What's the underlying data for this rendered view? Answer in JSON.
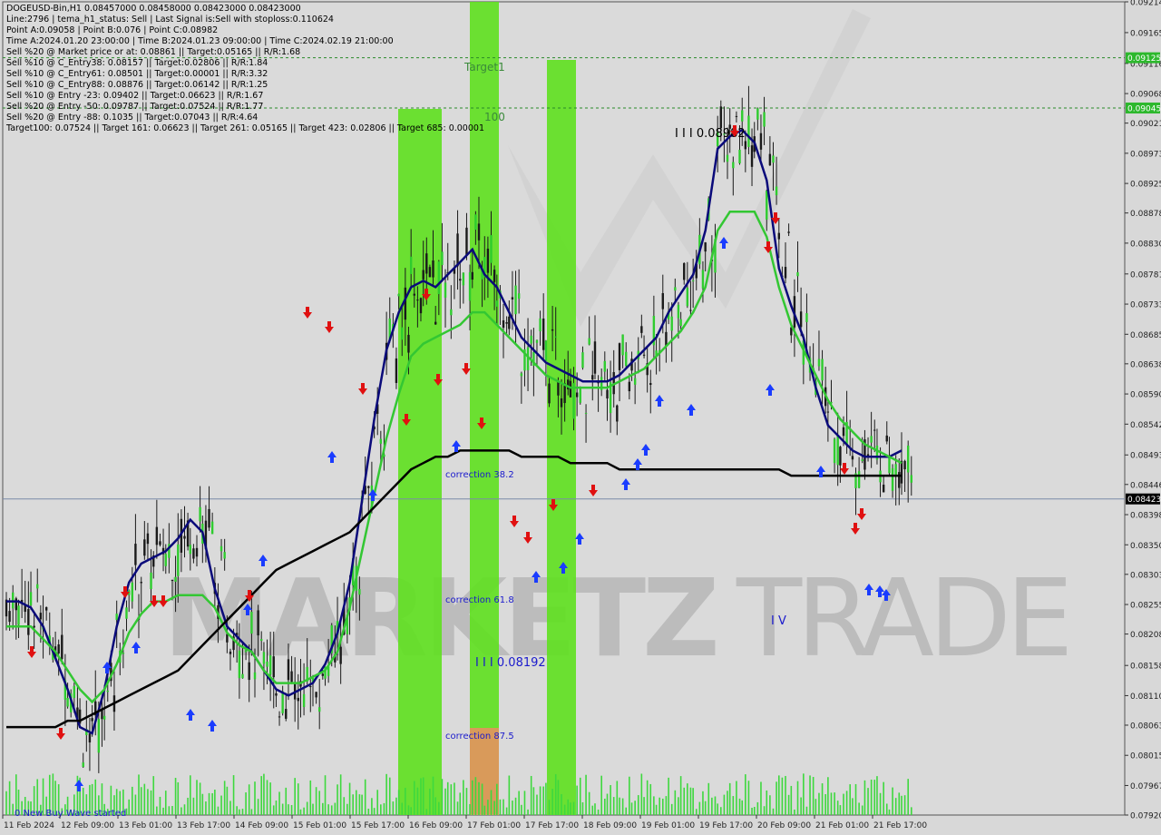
{
  "header": {
    "lines": [
      "DOGEUSD-Bin,H1  0.08457000 0.08458000 0.08423000 0.08423000",
      "Line:2796 | tema_h1_status: Sell | Last Signal is:Sell with stoploss:0.110624",
      "Point A:0.09058 | Point B:0.076 | Point C:0.08982",
      "Time A:2024.01.20 23:00:00 | Time B:2024.01.23 09:00:00 | Time C:2024.02.19 21:00:00",
      "Sell %20 @ Market price or at: 0.08861 || Target:0.05165 || R/R:1.68",
      "Sell %10 @ C_Entry38: 0.08157 || Target:0.02806 || R/R:1.84",
      "Sell %10 @ C_Entry61: 0.08501 || Target:0.00001 || R/R:3.32",
      "Sell %10 @ C_Entry88: 0.08876 || Target:0.06142 || R/R:1.25",
      "Sell %10 @ Entry -23: 0.09402 || Target:0.06623 || R/R:1.67",
      "Sell %20 @ Entry -50: 0.09787 || Target:0.07524 || R/R:1.77",
      "Sell %20 @ Entry -88: 0.1035 || Target:0.07043 || R/R:4.64",
      "Target100: 0.07524 || Target 161: 0.06623 || Target 261: 0.05165 || Target 423: 0.02806 || Target 685: 0.00001"
    ]
  },
  "watermark": {
    "left": "MARKETZ",
    "right": "TRADE"
  },
  "chart_data": {
    "type": "candlestick",
    "symbol": "DOGEUSD-Bin",
    "timeframe": "H1",
    "ylim": [
      0.0792,
      0.09214
    ],
    "y_ticks": [
      "0.09214",
      "0.09165",
      "0.09116",
      "0.09068",
      "0.09021",
      "0.08973",
      "0.08925",
      "0.08878",
      "0.08830",
      "0.08781",
      "0.08733",
      "0.08685",
      "0.08638",
      "0.08590",
      "0.08542",
      "0.08493",
      "0.08446",
      "0.08398",
      "0.08350",
      "0.08303",
      "0.08255",
      "0.08208",
      "0.08158",
      "0.08110",
      "0.08063",
      "0.08015",
      "0.07967",
      "0.07920"
    ],
    "x_ticks": [
      "11 Feb 2024",
      "12 Feb 09:00",
      "13 Feb 01:00",
      "13 Feb 17:00",
      "14 Feb 09:00",
      "15 Feb 01:00",
      "15 Feb 17:00",
      "16 Feb 09:00",
      "17 Feb 01:00",
      "17 Feb 17:00",
      "18 Feb 09:00",
      "19 Feb 01:00",
      "19 Feb 17:00",
      "20 Feb 09:00",
      "21 Feb 01:00",
      "21 Feb 17:00"
    ],
    "current_price": "0.08423",
    "horizontal_levels": [
      {
        "price": 0.09125,
        "label": "0.09125",
        "color": "#2db82d"
      },
      {
        "price": 0.09045,
        "label": "0.09045",
        "color": "#2db82d"
      }
    ],
    "zones": [
      {
        "label": "Target1",
        "start": "16 Feb 2024 19:00",
        "end": "17 Feb 01:00",
        "color": "#5ee01e"
      },
      {
        "label": "100",
        "start": "16 Feb 2024 09:00",
        "end": "16 Feb 2024 15:00",
        "color": "#5ee01e"
      },
      {
        "label": "",
        "start": "17 Feb 23:00",
        "end": "18 Feb 05:00",
        "color": "#5ee01e"
      },
      {
        "label": "correction 87.5",
        "color": "#d99a5a"
      }
    ],
    "annotations": [
      {
        "text": "I I I 0.08982",
        "color": "#000000"
      },
      {
        "text": "I I I 0.08192",
        "color": "#1a1acc"
      },
      {
        "text": "I V",
        "color": "#1a1acc"
      },
      {
        "text": "correction 38.2",
        "color": "#1a1acc"
      },
      {
        "text": "correction 61.8",
        "color": "#1a1acc"
      },
      {
        "text": "correction 87.5",
        "color": "#1a1acc"
      },
      {
        "text": "0 New Buy Wave started",
        "color": "#1a1acc"
      }
    ],
    "series": [
      {
        "name": "",
        "color": "#0a0a7a",
        "values": [
          0.0826,
          0.0826,
          0.0825,
          0.0822,
          0.0817,
          0.0812,
          0.0806,
          0.0805,
          0.0812,
          0.0822,
          0.0829,
          0.0832,
          0.0833,
          0.0834,
          0.0836,
          0.0839,
          0.0837,
          0.0828,
          0.0822,
          0.082,
          0.0818,
          0.0815,
          0.0812,
          0.0811,
          0.0812,
          0.0813,
          0.0816,
          0.0821,
          0.0829,
          0.0842,
          0.0855,
          0.0866,
          0.0872,
          0.0876,
          0.0877,
          0.0876,
          0.0878,
          0.088,
          0.0882,
          0.0878,
          0.0876,
          0.0872,
          0.0868,
          0.0866,
          0.0864,
          0.0863,
          0.0862,
          0.0861,
          0.0861,
          0.0861,
          0.0862,
          0.0864,
          0.0866,
          0.0868,
          0.0872,
          0.0875,
          0.0878,
          0.0885,
          0.0898,
          0.09,
          0.0901,
          0.0899,
          0.0893,
          0.0879,
          0.0873,
          0.0868,
          0.086,
          0.0854,
          0.0852,
          0.085,
          0.0849,
          0.0849,
          0.0849,
          0.085
        ]
      },
      {
        "name": "",
        "color": "#33c733",
        "values": [
          0.0822,
          0.0822,
          0.0822,
          0.082,
          0.0818,
          0.0815,
          0.0812,
          0.081,
          0.0812,
          0.0816,
          0.0821,
          0.0824,
          0.0826,
          0.0826,
          0.0827,
          0.0827,
          0.0827,
          0.0825,
          0.0821,
          0.0819,
          0.0818,
          0.0815,
          0.0813,
          0.0813,
          0.0813,
          0.0814,
          0.0815,
          0.0818,
          0.0825,
          0.0834,
          0.0843,
          0.0852,
          0.0859,
          0.0865,
          0.0867,
          0.0868,
          0.0869,
          0.087,
          0.0872,
          0.0872,
          0.087,
          0.0868,
          0.0866,
          0.0864,
          0.0862,
          0.0861,
          0.086,
          0.086,
          0.086,
          0.086,
          0.0861,
          0.0862,
          0.0863,
          0.0865,
          0.0867,
          0.0869,
          0.0872,
          0.0876,
          0.0885,
          0.0888,
          0.0888,
          0.0888,
          0.0884,
          0.0876,
          0.087,
          0.0866,
          0.0862,
          0.0858,
          0.0855,
          0.0853,
          0.0851,
          0.085,
          0.0849,
          0.0848
        ]
      },
      {
        "name": "",
        "color": "#000000",
        "values": [
          0.0806,
          0.0806,
          0.0806,
          0.0806,
          0.0806,
          0.0807,
          0.0807,
          0.0808,
          0.0809,
          0.081,
          0.0811,
          0.0812,
          0.0813,
          0.0814,
          0.0815,
          0.0817,
          0.0819,
          0.0821,
          0.0823,
          0.0825,
          0.0827,
          0.0829,
          0.0831,
          0.0832,
          0.0833,
          0.0834,
          0.0835,
          0.0836,
          0.0837,
          0.0839,
          0.0841,
          0.0843,
          0.0845,
          0.0847,
          0.0848,
          0.0849,
          0.0849,
          0.085,
          0.085,
          0.085,
          0.085,
          0.085,
          0.0849,
          0.0849,
          0.0849,
          0.0849,
          0.0848,
          0.0848,
          0.0848,
          0.0848,
          0.0847,
          0.0847,
          0.0847,
          0.0847,
          0.0847,
          0.0847,
          0.0847,
          0.0847,
          0.0847,
          0.0847,
          0.0847,
          0.0847,
          0.0847,
          0.0847,
          0.0846,
          0.0846,
          0.0846,
          0.0846,
          0.0846,
          0.0846,
          0.0846,
          0.0846,
          0.0846,
          0.0846
        ]
      }
    ],
    "grid": false,
    "legend": "none"
  }
}
